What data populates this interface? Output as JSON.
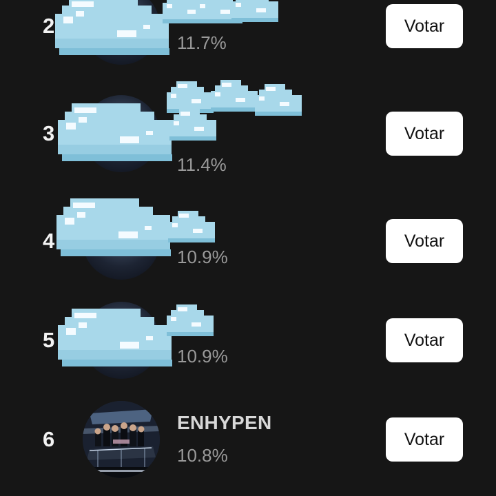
{
  "rows": [
    {
      "rank": "2",
      "name": "",
      "percent": "11.7%",
      "vote_label": "Votar"
    },
    {
      "rank": "3",
      "name": "",
      "percent": "11.4%",
      "vote_label": "Votar"
    },
    {
      "rank": "4",
      "name": "",
      "percent": "10.9%",
      "vote_label": "Votar"
    },
    {
      "rank": "5",
      "name": "",
      "percent": "10.9%",
      "vote_label": "Votar"
    },
    {
      "rank": "6",
      "name": "ENHYPEN",
      "percent": "10.8%",
      "vote_label": "Votar"
    }
  ],
  "colors": {
    "background": "#161616",
    "cloud_fill": "#a8d8ea",
    "cloud_shadow": "#7fbfd8",
    "cloud_highlight": "#f4fbff",
    "button_bg": "#ffffff"
  }
}
